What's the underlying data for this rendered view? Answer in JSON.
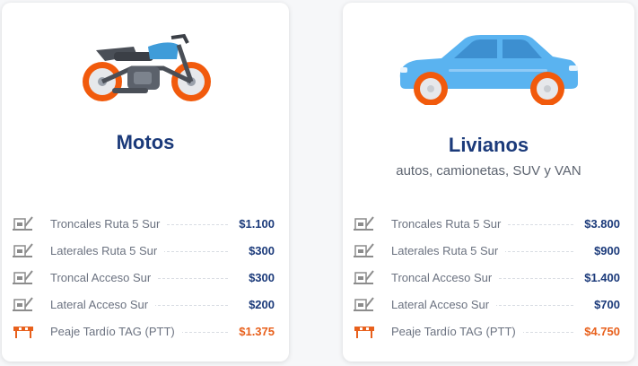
{
  "colors": {
    "title": "#1b3a7a",
    "price": "#1b3a7a",
    "late_price": "#e8601c",
    "tire": "#f15a0c",
    "car_body": "#5ab3f0",
    "moto_tank": "#3f9cd9"
  },
  "cards": [
    {
      "icon": "motorcycle-icon",
      "title": "Motos",
      "subtitle": "",
      "rates": [
        {
          "icon": "toll-booth-icon",
          "label": "Troncales Ruta 5 Sur",
          "price": "$1.100"
        },
        {
          "icon": "toll-booth-icon",
          "label": "Laterales Ruta 5 Sur",
          "price": "$300"
        },
        {
          "icon": "toll-booth-icon",
          "label": "Troncal Acceso Sur",
          "price": "$300"
        },
        {
          "icon": "toll-booth-icon",
          "label": "Lateral Acceso Sur",
          "price": "$200"
        },
        {
          "icon": "barrier-icon",
          "label": "Peaje Tardío TAG (PTT)",
          "price": "$1.375"
        }
      ]
    },
    {
      "icon": "car-icon",
      "title": "Livianos",
      "subtitle": "autos, camionetas, SUV y VAN",
      "rates": [
        {
          "icon": "toll-booth-icon",
          "label": "Troncales Ruta 5 Sur",
          "price": "$3.800"
        },
        {
          "icon": "toll-booth-icon",
          "label": "Laterales Ruta 5 Sur",
          "price": "$900"
        },
        {
          "icon": "toll-booth-icon",
          "label": "Troncal Acceso Sur",
          "price": "$1.400"
        },
        {
          "icon": "toll-booth-icon",
          "label": "Lateral Acceso Sur",
          "price": "$700"
        },
        {
          "icon": "barrier-icon",
          "label": "Peaje Tardío TAG (PTT)",
          "price": "$4.750"
        }
      ]
    }
  ]
}
